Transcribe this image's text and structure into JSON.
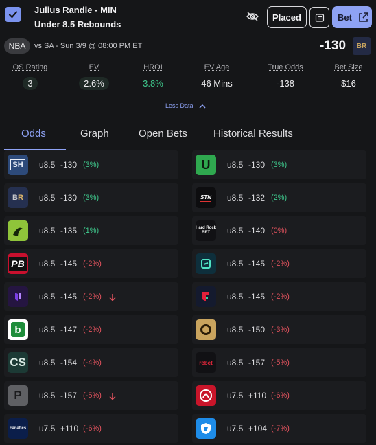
{
  "header": {
    "title_line1": "Julius Randle - MIN",
    "title_line2": "Under 8.5 Rebounds",
    "placed_label": "Placed",
    "bet_label": "Bet",
    "icons": [
      "checkbox-checked-icon",
      "eye-off-icon",
      "note-icon",
      "open-external-icon"
    ]
  },
  "game": {
    "league": "NBA",
    "matchup": "vs SA - Sun 3/9 @ 08:00 PM ET",
    "best_odds": "-130",
    "best_book": "BR"
  },
  "stats": [
    {
      "label": "OS Rating",
      "value": "3"
    },
    {
      "label": "EV",
      "value": "2.6%"
    },
    {
      "label": "HROI",
      "value": "3.8%"
    },
    {
      "label": "EV Age",
      "value": "46 Mins"
    },
    {
      "label": "True Odds",
      "value": "-138"
    },
    {
      "label": "Bet Size",
      "value": "$16"
    }
  ],
  "less_data_label": "Less Data",
  "tabs": [
    "Odds",
    "Graph",
    "Open Bets",
    "Historical Results"
  ],
  "active_tab": "Odds",
  "colors": {
    "accent": "#8ea2f4",
    "positive": "#3fc98d",
    "negative": "#e0525d",
    "background": "#151618"
  },
  "books": [
    {
      "name": "SH",
      "line": "u8.5",
      "odds": "-130",
      "pct": "(3%)",
      "dir": "pos",
      "arrow": false
    },
    {
      "name": "U",
      "line": "u8.5",
      "odds": "-130",
      "pct": "(3%)",
      "dir": "pos",
      "arrow": false
    },
    {
      "name": "BR",
      "line": "u8.5",
      "odds": "-130",
      "pct": "(3%)",
      "dir": "pos",
      "arrow": false
    },
    {
      "name": "STN",
      "line": "u8.5",
      "odds": "-132",
      "pct": "(2%)",
      "dir": "pos",
      "arrow": false
    },
    {
      "name": "DK",
      "line": "u8.5",
      "odds": "-135",
      "pct": "(1%)",
      "dir": "pos",
      "arrow": false
    },
    {
      "name": "Hard Rock",
      "line": "u8.5",
      "odds": "-140",
      "pct": "(0%)",
      "dir": "neg",
      "arrow": false
    },
    {
      "name": "PB",
      "line": "u8.5",
      "odds": "-145",
      "pct": "(-2%)",
      "dir": "neg",
      "arrow": false
    },
    {
      "name": "BB",
      "line": "u8.5",
      "odds": "-145",
      "pct": "(-2%)",
      "dir": "neg",
      "arrow": false
    },
    {
      "name": "U2",
      "line": "u8.5",
      "odds": "-145",
      "pct": "(-2%)",
      "dir": "neg",
      "arrow": true
    },
    {
      "name": "FD",
      "line": "u8.5",
      "odds": "-145",
      "pct": "(-2%)",
      "dir": "neg",
      "arrow": false
    },
    {
      "name": "b",
      "line": "u8.5",
      "odds": "-147",
      "pct": "(-2%)",
      "dir": "neg",
      "arrow": false
    },
    {
      "name": "MGM",
      "line": "u8.5",
      "odds": "-150",
      "pct": "(-3%)",
      "dir": "neg",
      "arrow": false
    },
    {
      "name": "CS",
      "line": "u8.5",
      "odds": "-154",
      "pct": "(-4%)",
      "dir": "neg",
      "arrow": false
    },
    {
      "name": "rebet",
      "line": "u8.5",
      "odds": "-157",
      "pct": "(-5%)",
      "dir": "neg",
      "arrow": false
    },
    {
      "name": "P",
      "line": "u8.5",
      "odds": "-157",
      "pct": "(-5%)",
      "dir": "neg",
      "arrow": true
    },
    {
      "name": "Circa",
      "line": "u7.5",
      "odds": "+110",
      "pct": "(-6%)",
      "dir": "neg",
      "arrow": false
    },
    {
      "name": "Fanatics",
      "line": "u7.5",
      "odds": "+110",
      "pct": "(-6%)",
      "dir": "neg",
      "arrow": false
    },
    {
      "name": "Shield",
      "line": "u7.5",
      "odds": "+104",
      "pct": "(-7%)",
      "dir": "neg",
      "arrow": false
    }
  ]
}
